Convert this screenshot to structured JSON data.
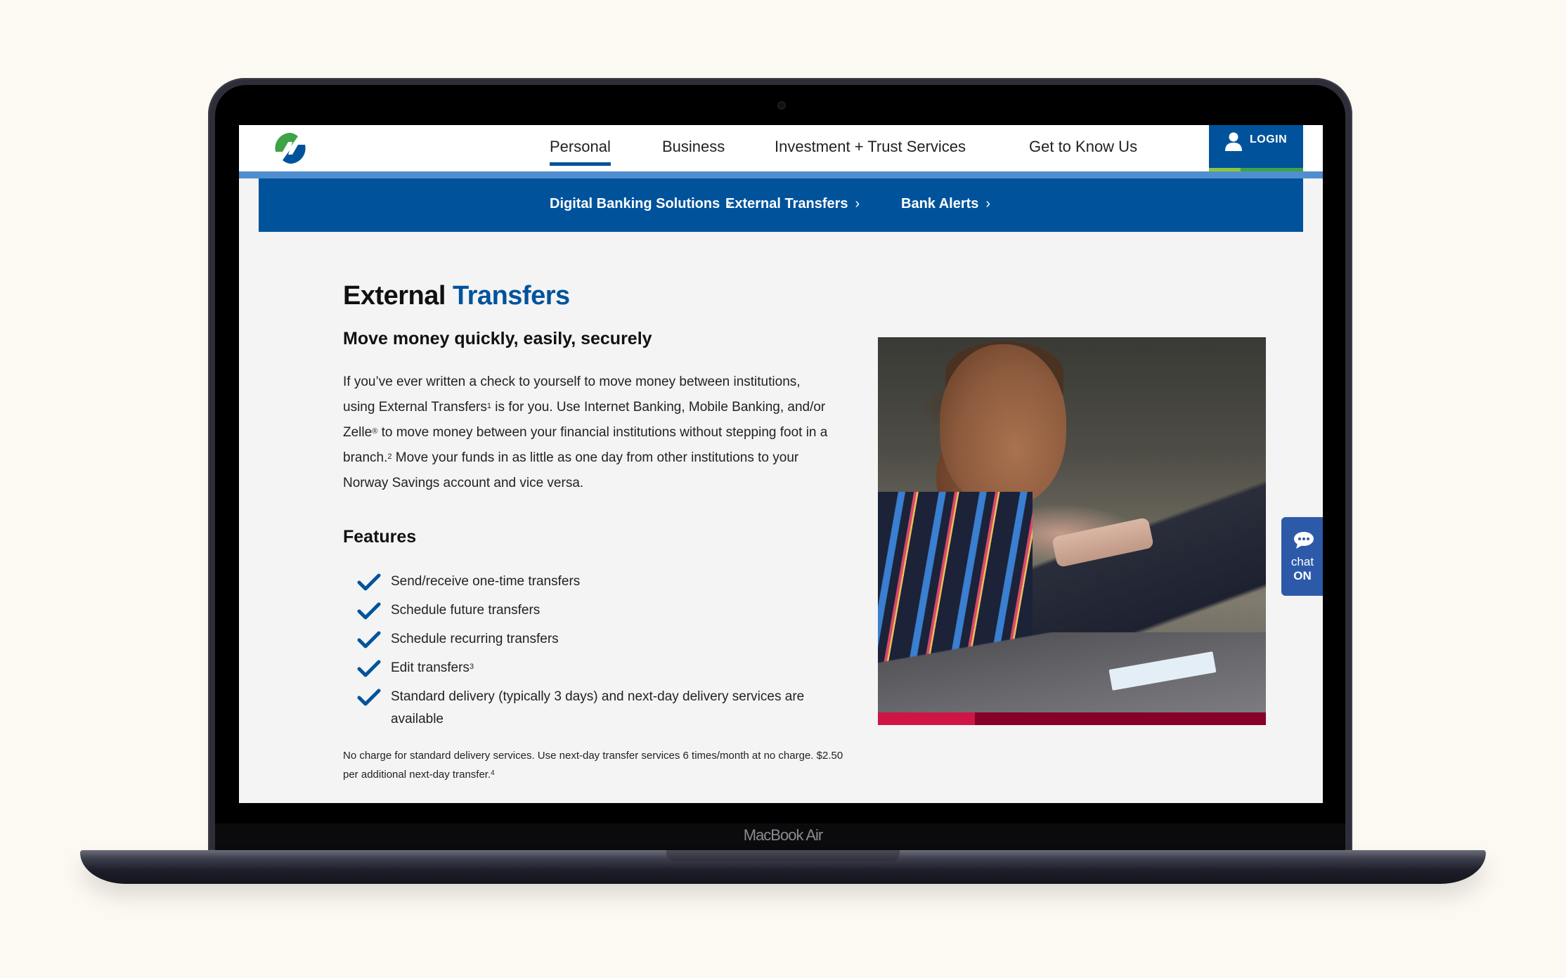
{
  "device": {
    "label": "MacBook Air"
  },
  "header": {
    "logo_alt": "Norway Savings Bank logo",
    "nav": [
      {
        "label": "Personal",
        "active": true
      },
      {
        "label": "Business",
        "active": false
      },
      {
        "label": "Investment + Trust Services",
        "active": false
      },
      {
        "label": "Get to Know Us",
        "active": false
      }
    ],
    "login_label": "LOGIN",
    "login_icon": "user-icon"
  },
  "subnav": {
    "items": [
      {
        "label": "Digital Banking Solutions",
        "icon": "chevron-right-icon"
      },
      {
        "label": "External Transfers",
        "icon": "chevron-right-icon"
      },
      {
        "label": "Bank Alerts",
        "icon": "chevron-right-icon"
      }
    ],
    "chevron": "›"
  },
  "main": {
    "title_part1": "External",
    "title_part2": "Transfers",
    "subtitle": "Move money quickly, easily, securely",
    "intro": {
      "t1": "If you’ve ever written a check to yourself to move money between institutions, using External Transfers",
      "s1": "1",
      "t2": " is for you. Use Internet Banking, Mobile Banking, and/or Zelle",
      "s2": "®",
      "t3": " to move money between your financial institutions without stepping foot in a branch.",
      "s3": "2",
      "t4": " Move your funds in as little as one day from other institutions to your Norway Savings account and vice versa."
    },
    "features_heading": "Features",
    "features": [
      {
        "text": "Send/receive one-time transfers",
        "sup": ""
      },
      {
        "text": "Schedule future transfers",
        "sup": ""
      },
      {
        "text": "Schedule recurring transfers",
        "sup": ""
      },
      {
        "text": "Edit transfers",
        "sup": "3"
      },
      {
        "text": "Standard delivery (typically 3 days) and next-day delivery services are available",
        "sup": ""
      }
    ],
    "footnote": {
      "text": "No charge for standard delivery services.  Use next-day transfer services 6 times/month at no charge. $2.50 per additional next-day transfer.",
      "sup": "4"
    },
    "image_alt": "Woman taking a photo of a check with her phone"
  },
  "chat": {
    "label": "chat",
    "status": "ON",
    "icon": "chat-bubble-icon"
  },
  "colors": {
    "brand_blue": "#00539b",
    "light_blue": "#4f8fd0",
    "green": "#3fa347",
    "lime": "#8cc63f",
    "red": "#cf1543",
    "dark_red": "#860027",
    "chat_blue": "#2d5aa8"
  }
}
